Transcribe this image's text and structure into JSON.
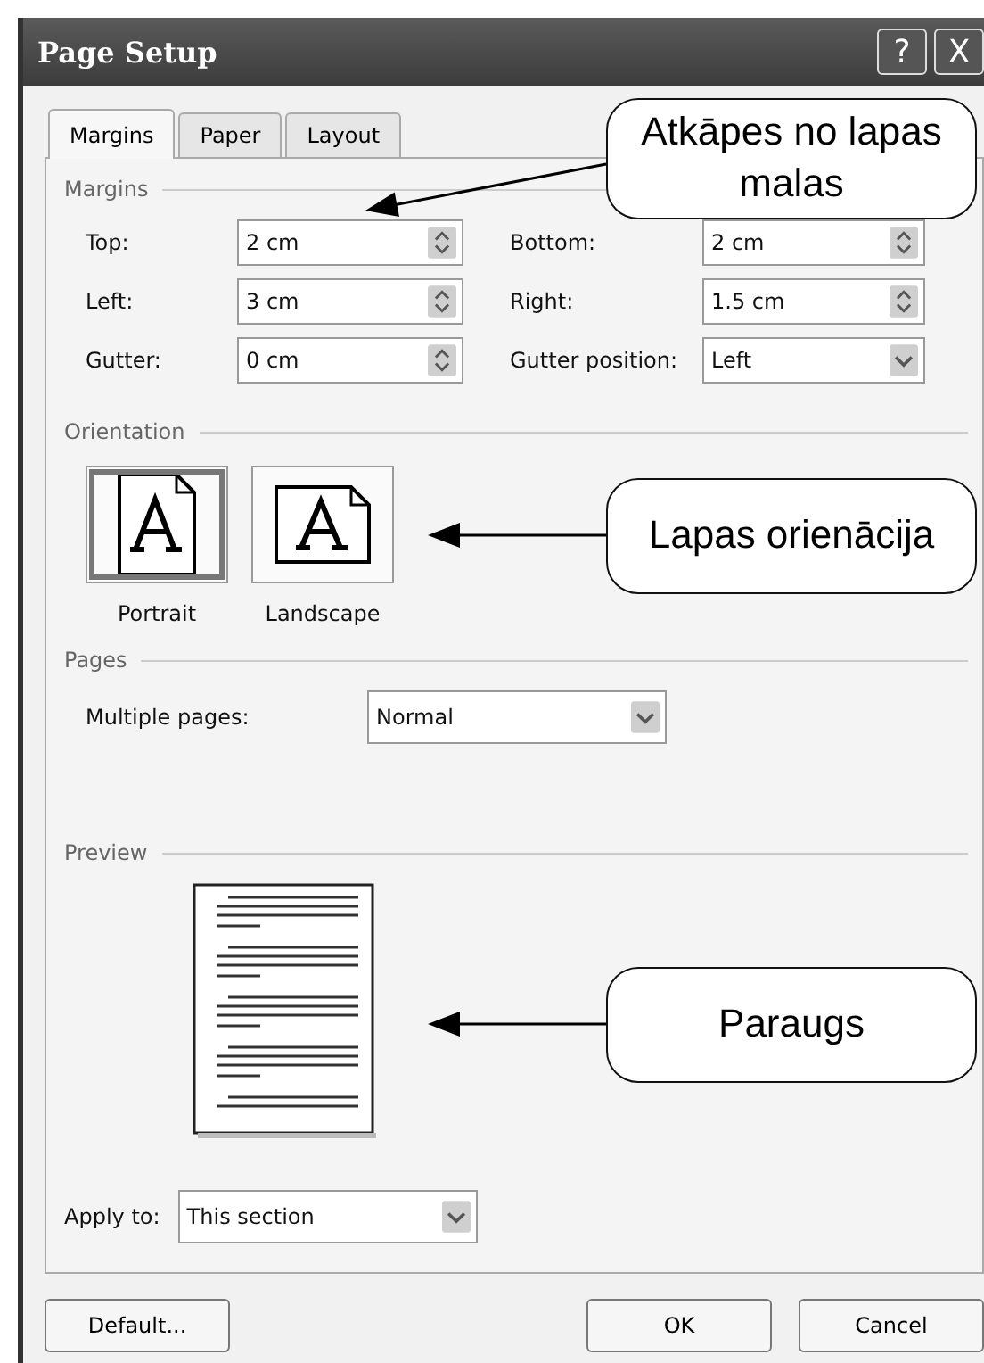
{
  "window": {
    "title": "Page Setup",
    "help_button": "?",
    "close_button": "X"
  },
  "tabs": [
    {
      "label": "Margins",
      "selected": true
    },
    {
      "label": "Paper",
      "selected": false
    },
    {
      "label": "Layout",
      "selected": false
    }
  ],
  "margins": {
    "heading": "Margins",
    "fields": [
      {
        "label": "Top:",
        "value": "2 cm",
        "kind": "spin"
      },
      {
        "label": "Bottom:",
        "value": "2 cm",
        "kind": "spin"
      },
      {
        "label": "Left:",
        "value": "3 cm",
        "kind": "spin"
      },
      {
        "label": "Right:",
        "value": "1.5 cm",
        "kind": "spin"
      },
      {
        "label": "Gutter:",
        "value": "0 cm",
        "kind": "spin"
      },
      {
        "label": "Gutter position:",
        "value": "Left",
        "kind": "select"
      }
    ]
  },
  "orientation": {
    "heading": "Orientation",
    "options": [
      {
        "label": "Portrait",
        "selected": true
      },
      {
        "label": "Landscape",
        "selected": false
      }
    ]
  },
  "pages": {
    "heading": "Pages",
    "label": "Multiple pages:",
    "value": "Normal"
  },
  "preview": {
    "heading": "Preview"
  },
  "apply_to": {
    "label": "Apply to:",
    "value": "This section"
  },
  "buttons": [
    {
      "label": "Default...",
      "kind": "left"
    },
    {
      "label": "OK",
      "kind": "right"
    },
    {
      "label": "Cancel",
      "kind": "right"
    }
  ],
  "callouts": [
    {
      "text": "Atkāpes no lapas malas"
    },
    {
      "text": "Lapas orienācija"
    },
    {
      "text": "Paraugs"
    }
  ]
}
